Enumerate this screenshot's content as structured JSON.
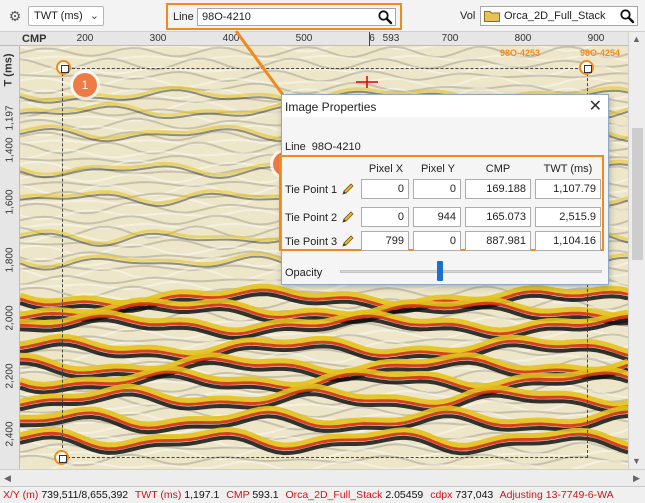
{
  "toolbar": {
    "settings_icon": "gear-icon",
    "axis_mode": "TWT (ms)",
    "line_label": "Line",
    "line_value": "98O-4210",
    "vol_label": "Vol",
    "vol_value": "Orca_2D_Full_Stack"
  },
  "cmp_axis": {
    "title": "CMP",
    "ticks": [
      "200",
      "300",
      "400",
      "500",
      "6",
      "593",
      "700",
      "800",
      "900"
    ],
    "current": "593"
  },
  "twt_axis": {
    "title": "T (ms)",
    "ticks": [
      "1,197",
      "1,400",
      "1,600",
      "1,800",
      "2,000",
      "2,200",
      "2,400"
    ]
  },
  "wells": [
    "98O-4253",
    "98O-4254"
  ],
  "callouts": [
    "1",
    "2",
    "3"
  ],
  "dialog": {
    "title": "Image Properties",
    "line_label": "Line",
    "line_value": "98O-4210",
    "columns": [
      "Pixel X",
      "Pixel Y",
      "CMP",
      "TWT (ms)"
    ],
    "tie_points": [
      {
        "label": "Tie Point 1",
        "pixel_x": "0",
        "pixel_y": "0",
        "cmp": "169.188",
        "twt": "1,107.79"
      },
      {
        "label": "Tie Point 2",
        "pixel_x": "0",
        "pixel_y": "944",
        "cmp": "165.073",
        "twt": "2,515.9"
      },
      {
        "label": "Tie Point 3",
        "pixel_x": "799",
        "pixel_y": "0",
        "cmp": "887.981",
        "twt": "1,104.16"
      }
    ],
    "opacity_label": "Opacity",
    "opacity_value": 0.38
  },
  "status": {
    "xy_label": "X/Y (m)",
    "xy_value": "739,511/8,655,392",
    "twt_label": "TWT (ms)",
    "twt_value": "1,197.1",
    "cmp_label": "CMP",
    "cmp_value": "593.1",
    "vol_label": "Orca_2D_Full_Stack",
    "vol_value": "2.05459",
    "cdpx_label": "cdpx",
    "cdpx_value": "737,043",
    "adjusting_label": "Adjusting",
    "adjusting_value": "13-7749-6-WA"
  },
  "colors": {
    "accent_orange": "#f08a1c",
    "callout": "#ee7b45",
    "status_key": "#d01414",
    "slider": "#1b6fd1"
  }
}
